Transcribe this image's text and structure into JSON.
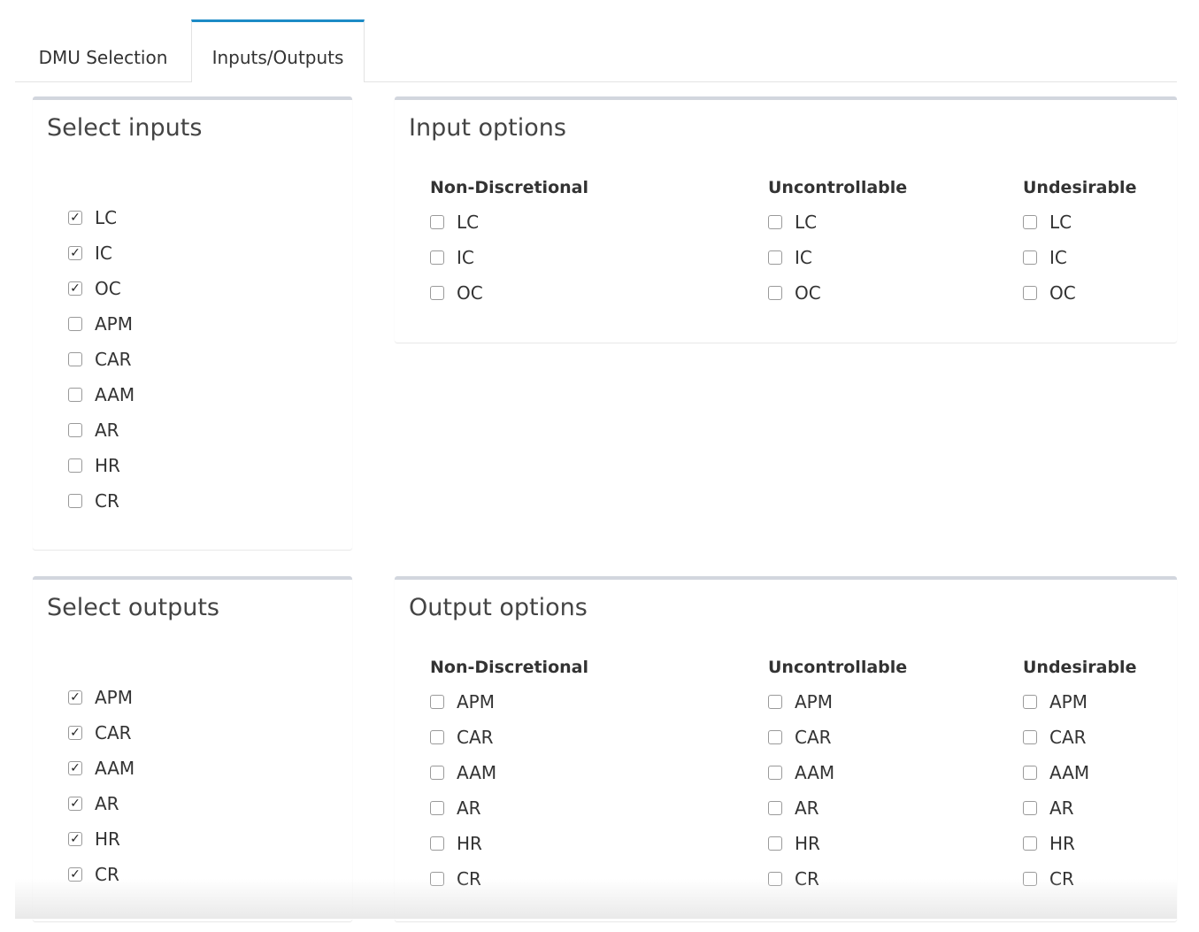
{
  "tabs": [
    {
      "label": "DMU Selection",
      "active": false
    },
    {
      "label": "Inputs/Outputs",
      "active": true
    }
  ],
  "accent_color": "#1c8bc6",
  "select_inputs": {
    "title": "Select inputs",
    "items": [
      {
        "label": "LC",
        "checked": true
      },
      {
        "label": "IC",
        "checked": true
      },
      {
        "label": "OC",
        "checked": true
      },
      {
        "label": "APM",
        "checked": false
      },
      {
        "label": "CAR",
        "checked": false
      },
      {
        "label": "AAM",
        "checked": false
      },
      {
        "label": "AR",
        "checked": false
      },
      {
        "label": "HR",
        "checked": false
      },
      {
        "label": "CR",
        "checked": false
      }
    ]
  },
  "input_options": {
    "title": "Input options",
    "columns": [
      {
        "heading": "Non-Discretional",
        "items": [
          {
            "label": "LC",
            "checked": false
          },
          {
            "label": "IC",
            "checked": false
          },
          {
            "label": "OC",
            "checked": false
          }
        ]
      },
      {
        "heading": "Uncontrollable",
        "items": [
          {
            "label": "LC",
            "checked": false
          },
          {
            "label": "IC",
            "checked": false
          },
          {
            "label": "OC",
            "checked": false
          }
        ]
      },
      {
        "heading": "Undesirable",
        "items": [
          {
            "label": "LC",
            "checked": false
          },
          {
            "label": "IC",
            "checked": false
          },
          {
            "label": "OC",
            "checked": false
          }
        ]
      }
    ]
  },
  "select_outputs": {
    "title": "Select outputs",
    "items": [
      {
        "label": "APM",
        "checked": true
      },
      {
        "label": "CAR",
        "checked": true
      },
      {
        "label": "AAM",
        "checked": true
      },
      {
        "label": "AR",
        "checked": true
      },
      {
        "label": "HR",
        "checked": true
      },
      {
        "label": "CR",
        "checked": true
      }
    ]
  },
  "output_options": {
    "title": "Output options",
    "columns": [
      {
        "heading": "Non-Discretional",
        "items": [
          {
            "label": "APM",
            "checked": false
          },
          {
            "label": "CAR",
            "checked": false
          },
          {
            "label": "AAM",
            "checked": false
          },
          {
            "label": "AR",
            "checked": false
          },
          {
            "label": "HR",
            "checked": false
          },
          {
            "label": "CR",
            "checked": false
          }
        ]
      },
      {
        "heading": "Uncontrollable",
        "items": [
          {
            "label": "APM",
            "checked": false
          },
          {
            "label": "CAR",
            "checked": false
          },
          {
            "label": "AAM",
            "checked": false
          },
          {
            "label": "AR",
            "checked": false
          },
          {
            "label": "HR",
            "checked": false
          },
          {
            "label": "CR",
            "checked": false
          }
        ]
      },
      {
        "heading": "Undesirable",
        "items": [
          {
            "label": "APM",
            "checked": false
          },
          {
            "label": "CAR",
            "checked": false
          },
          {
            "label": "AAM",
            "checked": false
          },
          {
            "label": "AR",
            "checked": false
          },
          {
            "label": "HR",
            "checked": false
          },
          {
            "label": "CR",
            "checked": false
          }
        ]
      }
    ]
  }
}
